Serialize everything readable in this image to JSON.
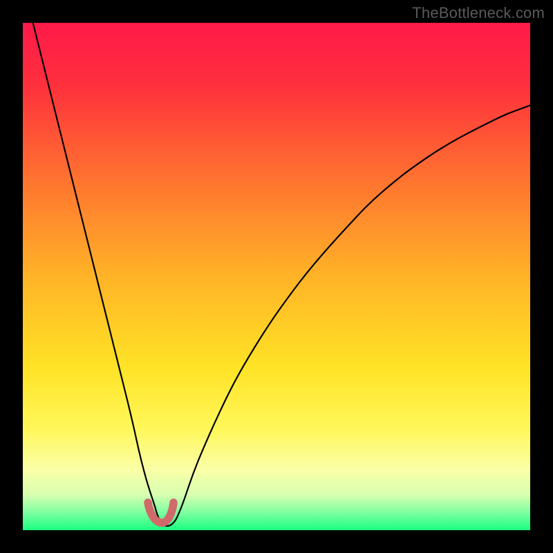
{
  "watermark": "TheBottleneck.com",
  "chart_data": {
    "type": "line",
    "title": "",
    "xlabel": "",
    "ylabel": "",
    "xlim": [
      0,
      100
    ],
    "ylim": [
      0,
      100
    ],
    "grid": false,
    "legend": false,
    "background": {
      "type": "vertical-gradient",
      "stops": [
        {
          "pos": 0.0,
          "color": "#ff1a4a"
        },
        {
          "pos": 0.12,
          "color": "#ff2f3d"
        },
        {
          "pos": 0.3,
          "color": "#ff7030"
        },
        {
          "pos": 0.5,
          "color": "#ffb327"
        },
        {
          "pos": 0.68,
          "color": "#ffe326"
        },
        {
          "pos": 0.8,
          "color": "#fff75a"
        },
        {
          "pos": 0.88,
          "color": "#faffa6"
        },
        {
          "pos": 0.93,
          "color": "#d8ffb0"
        },
        {
          "pos": 0.965,
          "color": "#7effa0"
        },
        {
          "pos": 1.0,
          "color": "#1aff80"
        }
      ]
    },
    "series": [
      {
        "name": "bottleneck-curve",
        "color": "#000000",
        "stroke_width": 2,
        "x": [
          2,
          5,
          8,
          11,
          14,
          17,
          19,
          21,
          22.5,
          24,
          25.5,
          27,
          28.5,
          30,
          33,
          36,
          40,
          45,
          50,
          56,
          62,
          70,
          80,
          90,
          100
        ],
        "y": [
          100,
          88,
          76,
          64,
          52,
          40,
          30,
          20,
          12,
          6,
          2,
          0,
          2,
          6,
          14,
          22,
          32,
          42,
          51,
          60,
          67,
          74,
          80,
          84,
          87
        ]
      }
    ],
    "annotations": [
      {
        "name": "trough-marker",
        "shape": "u-blob",
        "color": "#d06a6a",
        "x": 27,
        "y": 1.5,
        "width_x": 5.5,
        "height_y": 6
      }
    ]
  }
}
